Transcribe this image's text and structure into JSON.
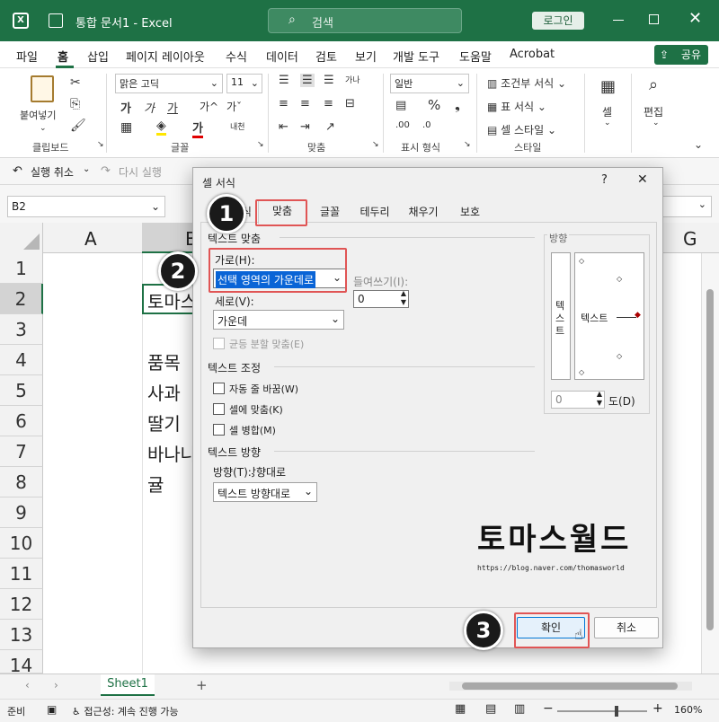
{
  "titlebar": {
    "doc_title": "통합 문서1 - Excel",
    "search_placeholder": "검색",
    "login": "로그인",
    "colors": {
      "bg": "#1e7145"
    }
  },
  "menu": {
    "items": [
      "파일",
      "홈",
      "삽입",
      "페이지 레이아웃",
      "수식",
      "데이터",
      "검토",
      "보기",
      "개발 도구",
      "도움말",
      "Acrobat"
    ],
    "share": "공유"
  },
  "ribbon": {
    "paste": "붙여넣기",
    "clipboard": "클립보드",
    "font_name": "맑은 고딕",
    "font_size": "11",
    "font_group": "글꼴",
    "align_group": "맞춤",
    "number_format": "일반",
    "number_group": "표시 형식",
    "cond_format": "조건부 서식",
    "table_format": "표 서식",
    "cell_style": "셀 스타일",
    "style_group": "스타일",
    "cells": "셀",
    "editing": "편집",
    "ga": "가",
    "ga_up": "가^",
    "ga_down": "가ˇ",
    "pct": "%"
  },
  "qat": {
    "undo": "실행 취소",
    "redo": "다시 실행"
  },
  "formula": {
    "name_box": "B2"
  },
  "grid": {
    "col_a": "A",
    "col_b": "B",
    "col_g": "G",
    "rows": [
      "1",
      "2",
      "3",
      "4",
      "5",
      "6",
      "7",
      "8",
      "9",
      "10",
      "11",
      "12",
      "13",
      "14"
    ],
    "cells": {
      "b2": "토마스",
      "b4": "품목",
      "b5": "사과",
      "b6": "딸기",
      "b7": "바나나",
      "b8": "귤"
    }
  },
  "sheetbar": {
    "sheet": "Sheet1"
  },
  "status": {
    "ready": "준비",
    "accessibility": "접근성: 계속 진행 가능",
    "zoom": "160%"
  },
  "dialog": {
    "title": "셀 서식",
    "help": "?",
    "tabs": [
      "표시 형식",
      "맞춤",
      "글꼴",
      "테두리",
      "채우기",
      "보호"
    ],
    "text_align": "텍스트 맞춤",
    "horizontal_label": "가로(H):",
    "horizontal_value": "선택 영역의 가운데로",
    "indent_label": "들여쓰기(I):",
    "indent_value": "0",
    "vertical_label": "세로(V):",
    "vertical_value": "가운데",
    "justify_distributed": "균등 분할 맞춤(E)",
    "text_control": "텍스트 조정",
    "wrap": "자동 줄 바꿈(W)",
    "shrink": "셀에 맞춤(K)",
    "merge": "셀 병합(M)",
    "direction_section": "텍스트 방향",
    "direction_label": "방향(T):",
    "direction_value": "텍스트 방향대로",
    "orientation": "방향",
    "vertical_text": [
      "텍",
      "스",
      "트"
    ],
    "orient_text": "텍스트",
    "degree_value": "0",
    "degree_label": "도(D)",
    "ok": "확인",
    "cancel": "취소"
  },
  "watermark": {
    "title": "토마스월드",
    "url": "https://blog.naver.com/thomasworld"
  },
  "badges": [
    "1",
    "2",
    "3"
  ]
}
